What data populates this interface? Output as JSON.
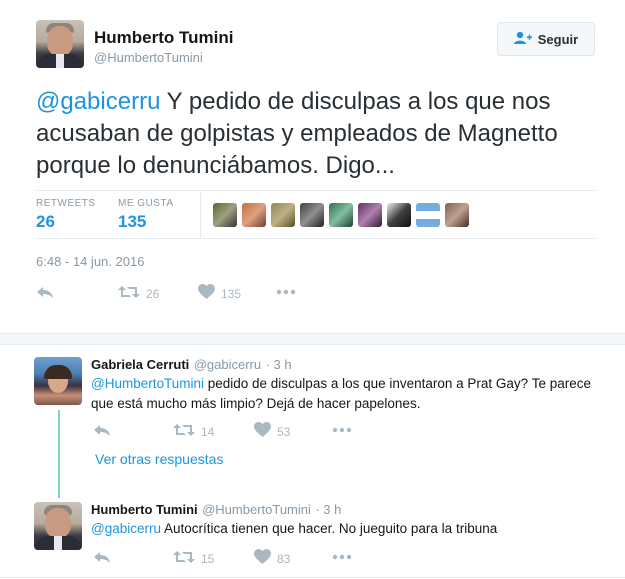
{
  "main_tweet": {
    "author_name": "Humberto Tumini",
    "author_handle": "@HumbertoTumini",
    "follow_label": "Seguir",
    "text_mention": "@gabicerru",
    "text_body": " Y pedido de disculpas a los que nos acusaban de golpistas y empleados de Magnetto porque lo denunciábamos. Digo...",
    "retweets_label": "RETWEETS",
    "retweets_count": "26",
    "likes_label": "ME GUSTA",
    "likes_count": "135",
    "timestamp": "6:48 - 14 jun. 2016",
    "actions": {
      "retweets": "26",
      "likes": "135"
    }
  },
  "replies": [
    {
      "author_name": "Gabriela Cerruti",
      "author_handle": "@gabicerru",
      "time": "· 3 h",
      "mention": "@HumbertoTumini",
      "text": " pedido de disculpas a los que inventaron a Prat Gay? Te parece que está mucho más limpio? Dejá de hacer papelones.",
      "retweets": "14",
      "likes": "53"
    },
    {
      "author_name": "Humberto Tumini",
      "author_handle": "@HumbertoTumini",
      "time": "· 3 h",
      "mention": "@gabicerru",
      "text": " Autocrítica tienen que hacer. No jueguito para la tribuna",
      "retweets": "15",
      "likes": "83"
    }
  ],
  "more_replies_label": "Ver otras respuestas",
  "colors": {
    "link": "#1b95e0",
    "muted": "#8899a6",
    "thread_line": "#7fd6c4"
  }
}
